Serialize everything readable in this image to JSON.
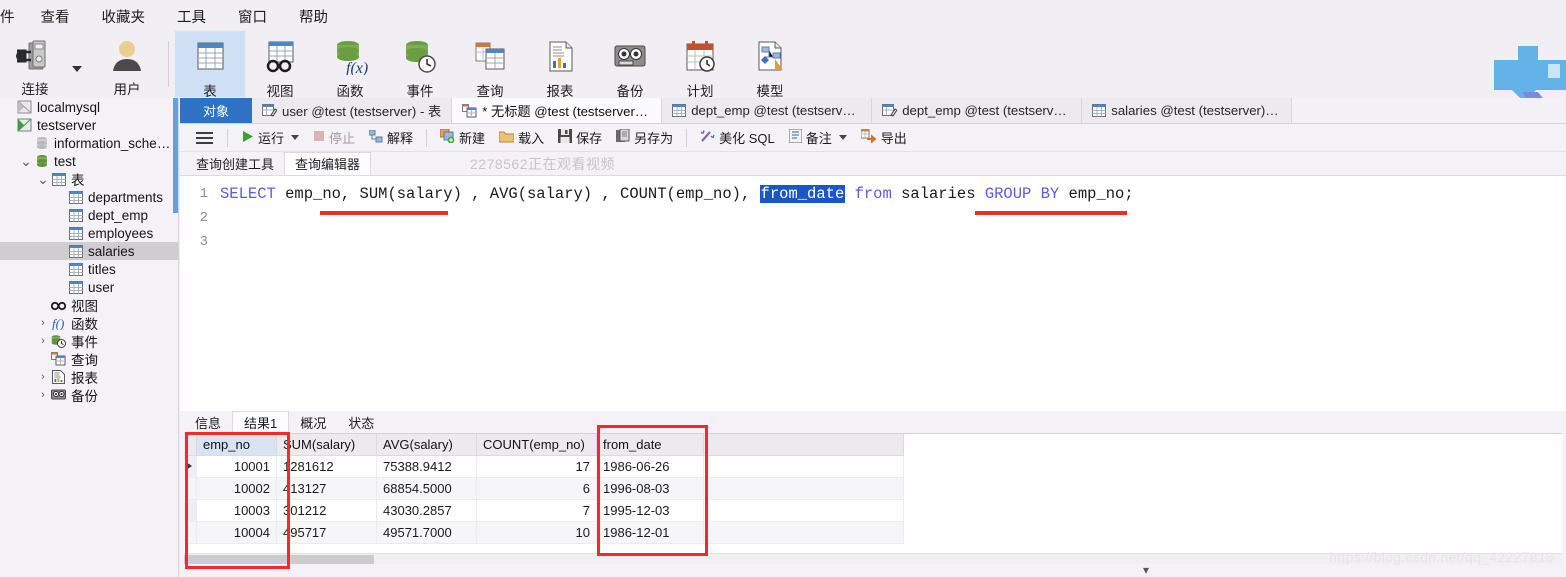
{
  "menu": {
    "items": [
      "件",
      "查看",
      "收藏夹",
      "工具",
      "窗口",
      "帮助"
    ]
  },
  "toolbar": {
    "items": [
      {
        "label": "连接",
        "icon": "connection-icon",
        "selected": false,
        "has_dropdown": true
      },
      {
        "label": "用户",
        "icon": "user-icon",
        "selected": false,
        "has_dropdown": false
      },
      {
        "label": "表",
        "icon": "table-icon",
        "selected": true,
        "has_dropdown": false
      },
      {
        "label": "视图",
        "icon": "view-icon",
        "selected": false,
        "has_dropdown": false
      },
      {
        "label": "函数",
        "icon": "function-icon",
        "selected": false,
        "has_dropdown": false
      },
      {
        "label": "事件",
        "icon": "event-icon",
        "selected": false,
        "has_dropdown": false
      },
      {
        "label": "查询",
        "icon": "query-icon",
        "selected": false,
        "has_dropdown": false
      },
      {
        "label": "报表",
        "icon": "report-icon",
        "selected": false,
        "has_dropdown": false
      },
      {
        "label": "备份",
        "icon": "backup-icon",
        "selected": false,
        "has_dropdown": false
      },
      {
        "label": "计划",
        "icon": "schedule-icon",
        "selected": false,
        "has_dropdown": false
      },
      {
        "label": "模型",
        "icon": "model-icon",
        "selected": false,
        "has_dropdown": false
      }
    ]
  },
  "sidebar": {
    "nodes": [
      {
        "label": "localmysql",
        "indent": 0,
        "icon": "server-gray-icon",
        "arrow": "",
        "selected": false
      },
      {
        "label": "testserver",
        "indent": 0,
        "icon": "server-green-icon",
        "arrow": "",
        "selected": false
      },
      {
        "label": "information_schema",
        "indent": 1,
        "icon": "database-gray-icon",
        "arrow": "",
        "selected": false
      },
      {
        "label": "test",
        "indent": 1,
        "icon": "database-green-icon",
        "arrow": "v",
        "selected": false
      },
      {
        "label": "表",
        "indent": 2,
        "icon": "table-icon",
        "arrow": "v",
        "selected": false
      },
      {
        "label": "departments",
        "indent": 3,
        "icon": "table-icon",
        "arrow": "",
        "selected": false
      },
      {
        "label": "dept_emp",
        "indent": 3,
        "icon": "table-icon",
        "arrow": "",
        "selected": false
      },
      {
        "label": "employees",
        "indent": 3,
        "icon": "table-icon",
        "arrow": "",
        "selected": false
      },
      {
        "label": "salaries",
        "indent": 3,
        "icon": "table-icon",
        "arrow": "",
        "selected": true
      },
      {
        "label": "titles",
        "indent": 3,
        "icon": "table-icon",
        "arrow": "",
        "selected": false
      },
      {
        "label": "user",
        "indent": 3,
        "icon": "table-icon",
        "arrow": "",
        "selected": false
      },
      {
        "label": "视图",
        "indent": 2,
        "icon": "view-icon",
        "arrow": "",
        "selected": false
      },
      {
        "label": "函数",
        "indent": 2,
        "icon": "function-icon",
        "arrow": ">",
        "selected": false
      },
      {
        "label": "事件",
        "indent": 2,
        "icon": "event-icon",
        "arrow": ">",
        "selected": false
      },
      {
        "label": "查询",
        "indent": 2,
        "icon": "query-icon",
        "arrow": "",
        "selected": false
      },
      {
        "label": "报表",
        "indent": 2,
        "icon": "report-icon",
        "arrow": ">",
        "selected": false
      },
      {
        "label": "备份",
        "indent": 2,
        "icon": "backup-icon",
        "arrow": ">",
        "selected": false
      }
    ]
  },
  "tabs": {
    "object_label": "对象",
    "documents": [
      {
        "label": "user @test (testserver) - 表",
        "icon": "table-designer-icon",
        "active": false
      },
      {
        "label": "* 无标题 @test (testserver) -...",
        "icon": "query-icon",
        "active": true
      },
      {
        "label": "dept_emp @test (testserver...",
        "icon": "table-icon",
        "active": false
      },
      {
        "label": "dept_emp @test (testserver...",
        "icon": "table-designer-icon",
        "active": false
      },
      {
        "label": "salaries @test (testserver) - ...",
        "icon": "table-icon",
        "active": false
      }
    ]
  },
  "query_toolbar": {
    "menu_icon": "hamburger-icon",
    "buttons": [
      {
        "label": "运行",
        "icon": "play-icon",
        "dropdown": true,
        "disabled": false
      },
      {
        "label": "停止",
        "icon": "stop-icon",
        "dropdown": false,
        "disabled": true
      },
      {
        "label": "解释",
        "icon": "explain-icon",
        "dropdown": false,
        "disabled": false
      },
      {
        "label": "新建",
        "icon": "new-icon",
        "dropdown": false,
        "disabled": false
      },
      {
        "label": "载入",
        "icon": "open-icon",
        "dropdown": false,
        "disabled": false
      },
      {
        "label": "保存",
        "icon": "save-icon",
        "dropdown": false,
        "disabled": false
      },
      {
        "label": "另存为",
        "icon": "save-as-icon",
        "dropdown": false,
        "disabled": false
      },
      {
        "label": "美化 SQL",
        "icon": "beautify-icon",
        "dropdown": false,
        "disabled": false
      },
      {
        "label": "备注",
        "icon": "note-icon",
        "dropdown": true,
        "disabled": false
      },
      {
        "label": "导出",
        "icon": "export-icon",
        "dropdown": false,
        "disabled": false
      }
    ]
  },
  "sub_tabs": {
    "items": [
      {
        "label": "查询创建工具",
        "active": false
      },
      {
        "label": "查询编辑器",
        "active": true
      }
    ],
    "watermark": "2278562正在观看视频"
  },
  "editor": {
    "line_numbers": [
      "1",
      "2",
      "3"
    ],
    "sql_tokens": [
      {
        "t": "SELECT",
        "k": "kw"
      },
      {
        "t": " ",
        "k": "tx"
      },
      {
        "t": "emp_no, ",
        "k": "tx"
      },
      {
        "t": "SUM",
        "k": "tx"
      },
      {
        "t": "(salary) , ",
        "k": "tx"
      },
      {
        "t": "AVG",
        "k": "tx"
      },
      {
        "t": "(salary) , ",
        "k": "tx"
      },
      {
        "t": "COUNT",
        "k": "tx"
      },
      {
        "t": "(emp_no), ",
        "k": "tx"
      },
      {
        "t": "from_date",
        "k": "sel"
      },
      {
        "t": " ",
        "k": "tx"
      },
      {
        "t": "from",
        "k": "kw"
      },
      {
        "t": " salaries ",
        "k": "tx"
      },
      {
        "t": "GROUP BY",
        "k": "kw"
      },
      {
        "t": " emp_no;",
        "k": "tx"
      }
    ],
    "selected_token": "from_date",
    "full_sql": "SELECT emp_no, SUM(salary) , AVG(salary) , COUNT(emp_no), from_date from salaries GROUP BY emp_no;"
  },
  "results": {
    "tabs": [
      {
        "label": "信息",
        "active": false
      },
      {
        "label": "结果1",
        "active": true
      },
      {
        "label": "概况",
        "active": false
      },
      {
        "label": "状态",
        "active": false
      }
    ],
    "columns": [
      "emp_no",
      "SUM(salary)",
      "AVG(salary)",
      "COUNT(emp_no)",
      "from_date"
    ],
    "rows": [
      {
        "emp_no": "10001",
        "sum": "1281612",
        "avg": "75388.9412",
        "count": "17",
        "from_date": "1986-06-26"
      },
      {
        "emp_no": "10002",
        "sum": "413127",
        "avg": "68854.5000",
        "count": "6",
        "from_date": "1996-08-03"
      },
      {
        "emp_no": "10003",
        "sum": "301212",
        "avg": "43030.2857",
        "count": "7",
        "from_date": "1995-12-03"
      },
      {
        "emp_no": "10004",
        "sum": "495717",
        "avg": "49571.7000",
        "count": "10",
        "from_date": "1986-12-01"
      }
    ]
  },
  "annotations": {
    "color": "#f42a2a",
    "marks": [
      "emp_no-underline-in-sql",
      "from_date-underline-in-sql",
      "emp_no-column-box",
      "from_date-column-box"
    ]
  },
  "watermarks": {
    "bottom_right": "https://blog.csdn.net/qq_42227818"
  }
}
